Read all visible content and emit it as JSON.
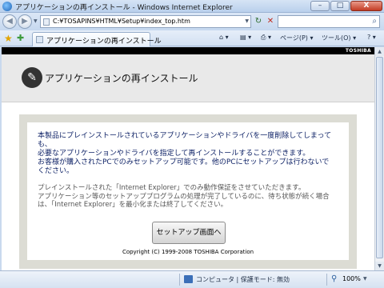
{
  "window": {
    "title": "アプリケーションの再インストール - Windows Internet Explorer",
    "minimize": "–",
    "maximize": "□",
    "close": "X"
  },
  "address": {
    "url": "C:¥TOSAPINS¥HTML¥Setup¥index_top.htm",
    "back": "◀",
    "forward": "▶",
    "dropdown": "▼",
    "refresh": "↻",
    "stop": "✕",
    "search_icon": "⌕"
  },
  "toolbar": {
    "favorites_icon": "★",
    "add_favorites_icon": "✚",
    "tab_label": "アプリケーションの再インストール",
    "home": "⌂ ▾",
    "feeds": "▤ ▾",
    "print": "⎙ ▾",
    "page_menu": "ページ(P) ▾",
    "tools_menu": "ツール(O) ▾",
    "help": "? ▾"
  },
  "page": {
    "brand": "TOSHIBA",
    "title": "アプリケーションの再インストール",
    "wrench_icon": "✎",
    "paragraph1_lines": [
      "本製品にプレインストールされているアプリケーションやドライバを一度削除してしまっても、",
      "必要なアプリケーションやドライバを指定して再インストールすることができます。",
      "お客様が購入されたPCでのみセットアップ可能です。他のPCにセットアップは行わないでください。"
    ],
    "paragraph2_lines": [
      "プレインストールされた「Internet Explorer」でのみ動作保証をさせていただきます。",
      "アプリケーション等のセットアッププログラムの処理が完了しているのに、待ち状態が続く場合は、「Internet Explorer」を最小化または終了してください。"
    ],
    "setup_button": "セットアップ画面へ",
    "copyright": "Copyright (C) 1999-2008 TOSHIBA Corporation"
  },
  "statusbar": {
    "zone": "コンピュータ | 保護モード: 無効",
    "zoom": "100%",
    "zoom_dropdown": "▼"
  },
  "scrollbar": {
    "up": "▲",
    "down": "▼"
  }
}
